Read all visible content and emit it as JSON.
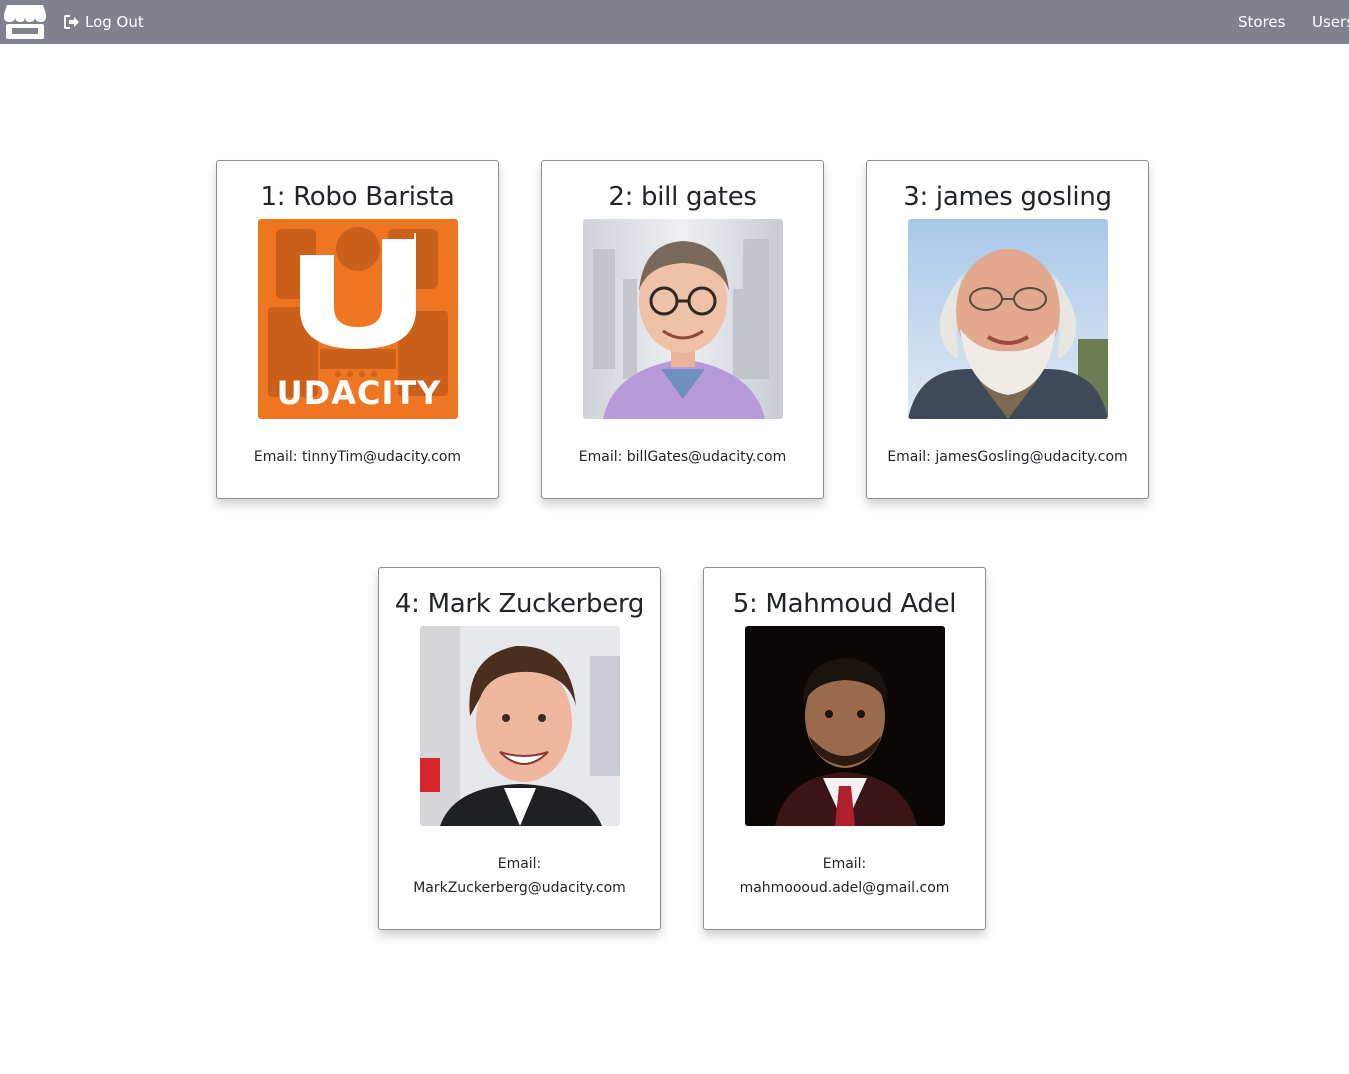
{
  "nav": {
    "logout_label": "Log Out",
    "links": [
      "Stores",
      "Users"
    ]
  },
  "users": [
    {
      "title": "1: Robo Barista",
      "email_label": "Email:",
      "email": "tinnyTim@udacity.com",
      "logo_text": "UDACITY"
    },
    {
      "title": "2: bill gates",
      "email_label": "Email:",
      "email": "billGates@udacity.com"
    },
    {
      "title": "3: james gosling",
      "email_label": "Email:",
      "email": "jamesGosling@udacity.com"
    },
    {
      "title": "4: Mark Zuckerberg",
      "email_label": "Email:",
      "email": "MarkZuckerberg@udacity.com"
    },
    {
      "title": "5: Mahmoud Adel",
      "email_label": "Email:",
      "email": "mahmoooud.adel@gmail.com"
    }
  ],
  "colors": {
    "navbar": "#7f828d",
    "udacity_orange": "#ee7622",
    "card_border": "#8e8e8e"
  },
  "icons": {
    "logo": "store-icon",
    "logout": "sign-out-icon"
  }
}
